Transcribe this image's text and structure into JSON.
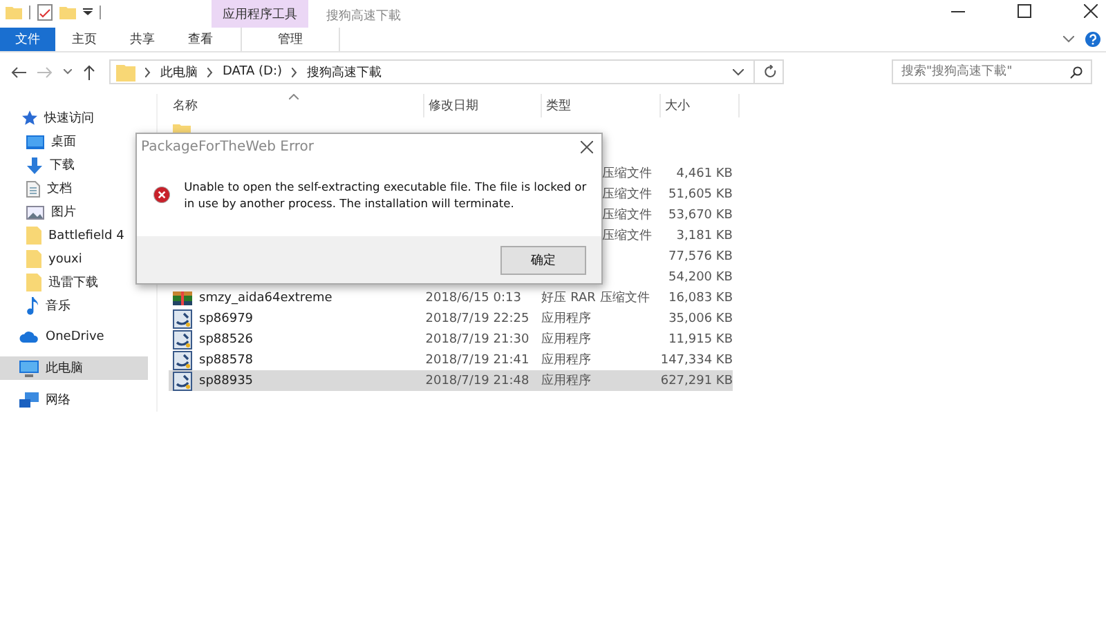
{
  "window": {
    "title": "搜狗高速下載",
    "context_tab": "应用程序工具"
  },
  "ribbon_tabs": [
    {
      "label": "文件",
      "kind": "file",
      "selected": false
    },
    {
      "label": "主页",
      "kind": "tab",
      "selected": false
    },
    {
      "label": "共享",
      "kind": "tab",
      "selected": false
    },
    {
      "label": "查看",
      "kind": "tab",
      "selected": false
    },
    {
      "label": "管理",
      "kind": "context",
      "selected": true
    }
  ],
  "address": {
    "path": [
      "此电脑",
      "DATA (D:)",
      "搜狗高速下載"
    ]
  },
  "search": {
    "placeholder": "搜索\"搜狗高速下載\""
  },
  "sidebar": {
    "items": [
      {
        "label": "快速访问",
        "kind": "star",
        "selected": false
      },
      {
        "label": "桌面",
        "kind": "desktop",
        "selected": false
      },
      {
        "label": "下载",
        "kind": "download",
        "selected": false
      },
      {
        "label": "文档",
        "kind": "document",
        "selected": false
      },
      {
        "label": "图片",
        "kind": "pictures",
        "selected": false
      },
      {
        "label": "Battlefield 4",
        "kind": "folder",
        "selected": false
      },
      {
        "label": "youxi",
        "kind": "folder",
        "selected": false
      },
      {
        "label": "迅雷下载",
        "kind": "folder",
        "selected": false
      },
      {
        "label": "音乐",
        "kind": "music",
        "selected": false
      },
      {
        "label": "OneDrive",
        "kind": "cloud",
        "selected": false
      },
      {
        "label": "此电脑",
        "kind": "pc",
        "selected": true
      },
      {
        "label": "网络",
        "kind": "network",
        "selected": false
      }
    ]
  },
  "table": {
    "columns": [
      "名称",
      "修改日期",
      "类型",
      "大小"
    ],
    "rows": [
      {
        "kind": "folder",
        "selected": false
      },
      {
        "kind": "hidden",
        "selected": false
      },
      {
        "kind": "hidden",
        "type": "压缩文件",
        "size": "4,461 KB",
        "selected": false
      },
      {
        "kind": "hidden",
        "type": "压缩文件",
        "size": "51,605 KB",
        "selected": false
      },
      {
        "kind": "hidden",
        "type": "压缩文件",
        "size": "53,670 KB",
        "selected": false
      },
      {
        "kind": "hidden",
        "type": "压缩文件",
        "size": "3,181 KB",
        "selected": false
      },
      {
        "kind": "hidden",
        "size": "77,576 KB",
        "selected": false
      },
      {
        "kind": "hidden",
        "size": "54,200 KB",
        "selected": false
      },
      {
        "kind": "rar",
        "name": "smzy_aida64extreme",
        "date": "2018/6/15 0:13",
        "type": "好压 RAR 压缩文件",
        "size": "16,083 KB",
        "selected": false
      },
      {
        "kind": "exe",
        "name": "sp86979",
        "date": "2018/7/19 22:25",
        "type": "应用程序",
        "size": "35,006 KB",
        "selected": false
      },
      {
        "kind": "exe",
        "name": "sp88526",
        "date": "2018/7/19 21:30",
        "type": "应用程序",
        "size": "11,915 KB",
        "selected": false
      },
      {
        "kind": "exe",
        "name": "sp88578",
        "date": "2018/7/19 21:41",
        "type": "应用程序",
        "size": "147,334 KB",
        "selected": false
      },
      {
        "kind": "exe",
        "name": "sp88935",
        "date": "2018/7/19 21:48",
        "type": "应用程序",
        "size": "627,291 KB",
        "selected": true
      }
    ]
  },
  "dialog": {
    "title": "PackageForTheWeb Error",
    "message": "Unable to open the self-extracting executable file.  The file is locked or in use by another process.  The installation will terminate.",
    "button": "确定"
  }
}
